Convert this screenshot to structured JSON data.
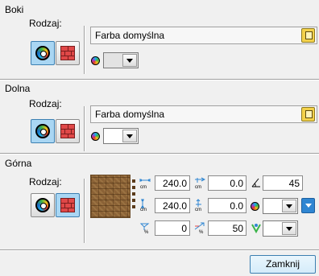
{
  "sections": {
    "boki": {
      "title": "Boki",
      "type_label": "Rodzaj:",
      "material": "Farba domyślna"
    },
    "dolna": {
      "title": "Dolna",
      "type_label": "Rodzaj:",
      "material": "Farba domyślna"
    },
    "gorna": {
      "title": "Górna",
      "type_label": "Rodzaj:"
    }
  },
  "params": {
    "width": "240.0",
    "offset_x": "0.0",
    "angle": "45",
    "height": "240.0",
    "offset_y": "0.0",
    "scale_x": "0",
    "scale_y": "50"
  },
  "footer": {
    "close_label": "Zamknij"
  },
  "colors": {
    "accent": "#3c7fb1",
    "brick": "#e04848",
    "spin": "#2f86d2"
  }
}
